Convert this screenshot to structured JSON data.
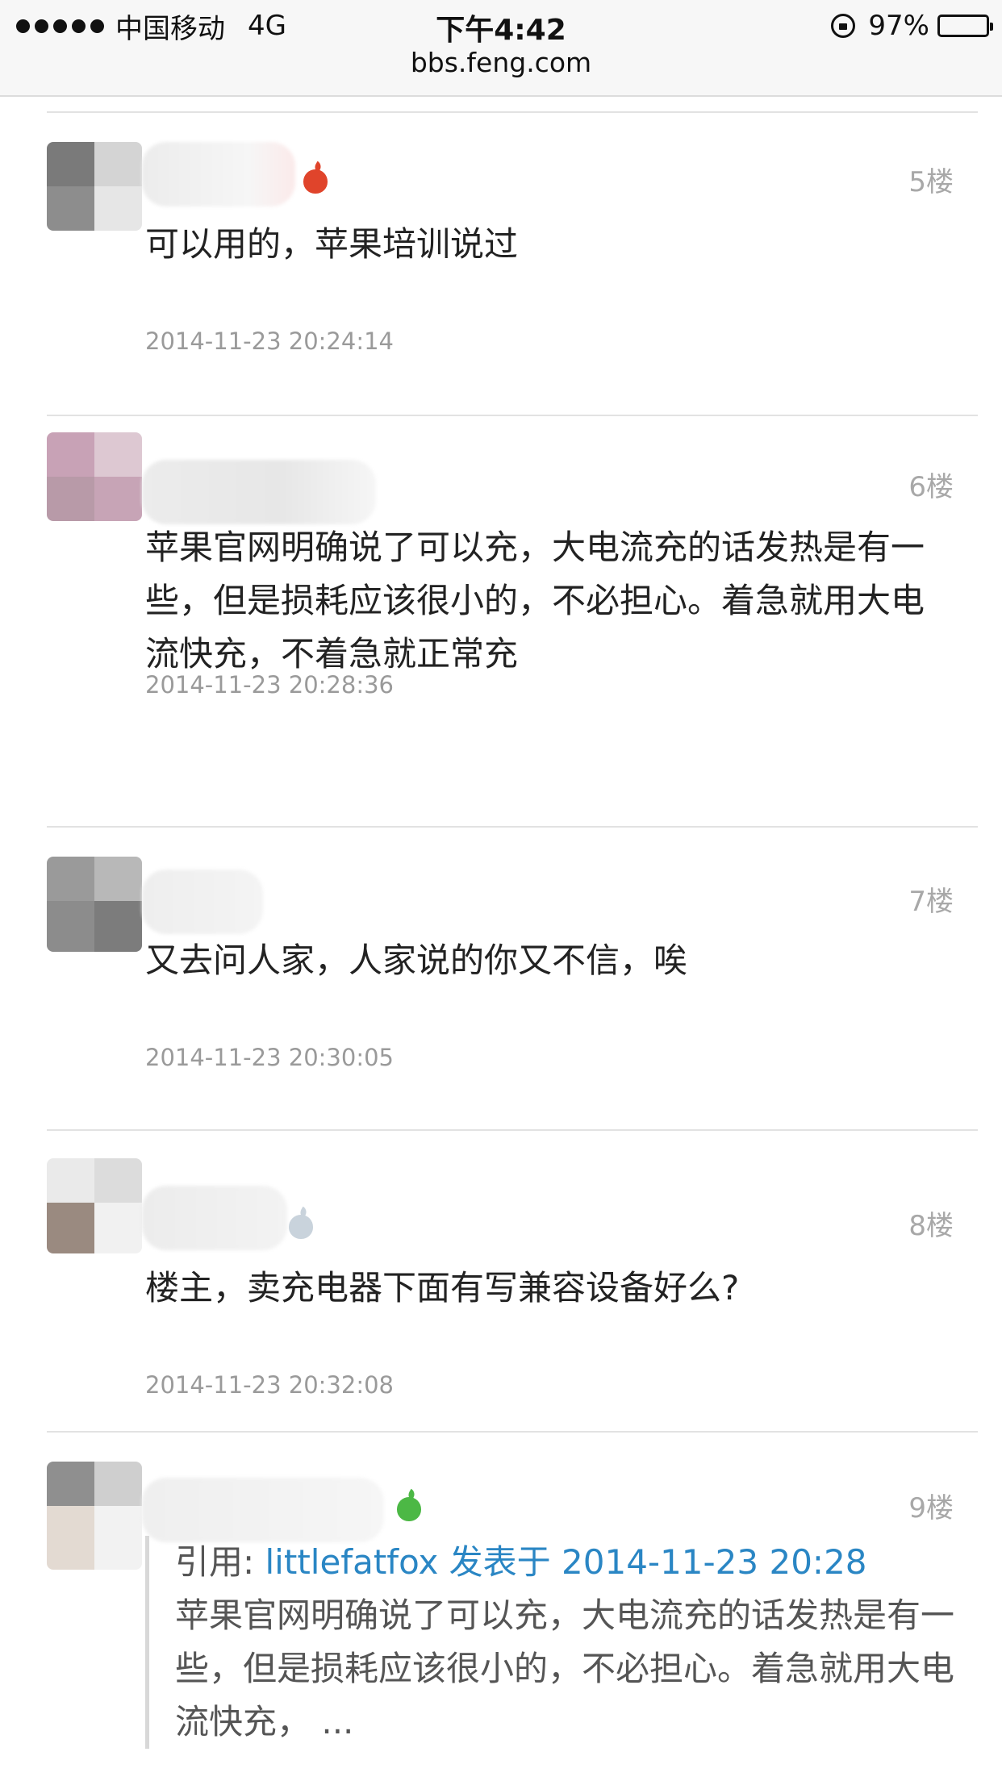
{
  "status_bar": {
    "carrier": "中国移动",
    "network": "4G",
    "time": "下午4:42",
    "battery": "97%",
    "battery_level": 0.97
  },
  "address_bar": {
    "url": "bbs.feng.com"
  },
  "posts": [
    {
      "floor": "5楼",
      "content": "可以用的，苹果培训说过",
      "time": "2014-11-23 20:24:14",
      "badge_color": "#e0442b"
    },
    {
      "floor": "6楼",
      "content": "苹果官网明确说了可以充，大电流充的话发热是有一些，但是损耗应该很小的，不必担心。着急就用大电流快充，不着急就正常充",
      "time": "2014-11-23 20:28:36"
    },
    {
      "floor": "7楼",
      "content": "又去问人家，人家说的你又不信，唉",
      "time": "2014-11-23 20:30:05"
    },
    {
      "floor": "8楼",
      "content": "楼主，卖充电器下面有写兼容设备好么?",
      "time": "2014-11-23 20:32:08",
      "badge_color": "#c9d3dc"
    },
    {
      "floor": "9楼",
      "badge_color": "#4cb845",
      "quote": {
        "prefix": "引用: ",
        "link": "littlefatfox 发表于 2014-11-23 20:28",
        "body": "苹果官网明确说了可以充，大电流充的话发热是有一些，但是损耗应该很小的，不必担心。着急就用大电流快充，   ..."
      }
    }
  ],
  "icons": [
    "signal-dots-icon",
    "rotation-lock-icon",
    "battery-icon",
    "apple-badge-icon"
  ]
}
